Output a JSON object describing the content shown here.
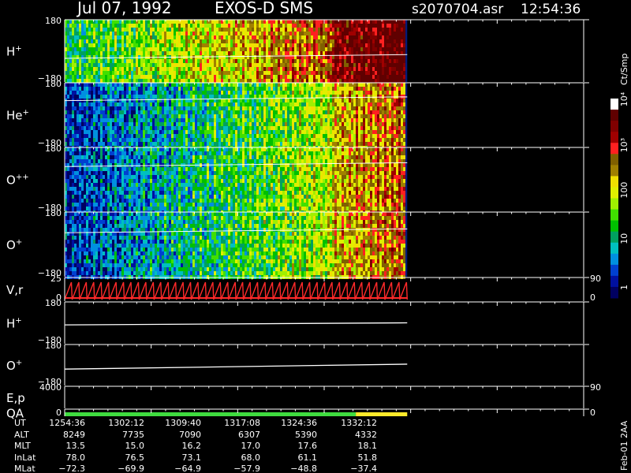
{
  "header": {
    "date": "Jul 07, 1992",
    "instrument": "EXOS-D SMS",
    "file": "s2070704.asr",
    "time": "12:54:36"
  },
  "chart_data": {
    "type": "heatmap",
    "panels": [
      {
        "id": "H",
        "base": "H",
        "sup": "+",
        "kind": "spectrogram",
        "ytop": "180",
        "ybot": "−180",
        "level": 0.62
      },
      {
        "id": "He",
        "base": "He",
        "sup": "+",
        "kind": "spectrogram",
        "ytop": "180",
        "ybot": "−180",
        "level": 0.28
      },
      {
        "id": "O2",
        "base": "O",
        "sup": "++",
        "kind": "spectrogram",
        "ytop": "180",
        "ybot": "−180",
        "level": 0.3
      },
      {
        "id": "O",
        "base": "O",
        "sup": "+",
        "kind": "spectrogram",
        "ytop": "180",
        "ybot": "−180",
        "level": 0.32
      },
      {
        "id": "Vr",
        "base": "V,r",
        "sup": "",
        "kind": "sawtooth",
        "ytop": "25",
        "ybot": "0",
        "rtop": "90",
        "rbot": "0"
      },
      {
        "id": "Hline",
        "base": "H",
        "sup": "+",
        "kind": "line",
        "ytop": "180",
        "ybot": "−180",
        "y_start": 0.55,
        "y_end": 0.5
      },
      {
        "id": "Oline",
        "base": "O",
        "sup": "+",
        "kind": "line",
        "ytop": "180",
        "ybot": "−180",
        "y_start": 0.6,
        "y_end": 0.48
      },
      {
        "id": "Ep",
        "base": "E,p",
        "sup": "",
        "kind": "empty",
        "ytop": "4000",
        "ybot": "",
        "rtop": "90",
        "rbot": ""
      },
      {
        "id": "QA",
        "base": "QA",
        "sup": "",
        "kind": "qa",
        "ytop": "",
        "ybot": "0",
        "rtop": "",
        "rbot": "0"
      }
    ],
    "qa_segments": [
      {
        "from": 0.0,
        "to": 0.85,
        "color": "#3fdc3f"
      },
      {
        "from": 0.85,
        "to": 1.0,
        "color": "#ffea2a"
      }
    ],
    "data_extent_fraction": 0.66,
    "colorbar": {
      "title": "Ct/Smp",
      "labels": [
        "1",
        "10",
        "100",
        "10³",
        "10⁴"
      ],
      "scale": "log",
      "colors": [
        "#000060",
        "#0010a0",
        "#0040d0",
        "#0090e0",
        "#00c0c0",
        "#00a060",
        "#00c000",
        "#40e000",
        "#a0f000",
        "#e0f000",
        "#f0e000",
        "#a08000",
        "#806000",
        "#ff2020",
        "#a00000",
        "#800000",
        "#600000",
        "#ffffff"
      ]
    },
    "ephemeris": {
      "labels": [
        "UT",
        "ALT",
        "MLT",
        "InLat",
        "MLat"
      ],
      "columns": [
        [
          "1254:36",
          "8249",
          "13.5",
          "78.0",
          "−72.3"
        ],
        [
          "1302:12",
          "7735",
          "15.0",
          "76.5",
          "−69.9"
        ],
        [
          "1309:40",
          "7090",
          "16.2",
          "73.1",
          "−64.9"
        ],
        [
          "1317:08",
          "6307",
          "17.0",
          "68.0",
          "−57.9"
        ],
        [
          "1324:36",
          "5390",
          "17.6",
          "61.1",
          "−48.8"
        ],
        [
          "1332:12",
          "4332",
          "18.1",
          "51.8",
          "−37.4"
        ]
      ]
    },
    "footer_note": "Feb-01 2AA"
  }
}
